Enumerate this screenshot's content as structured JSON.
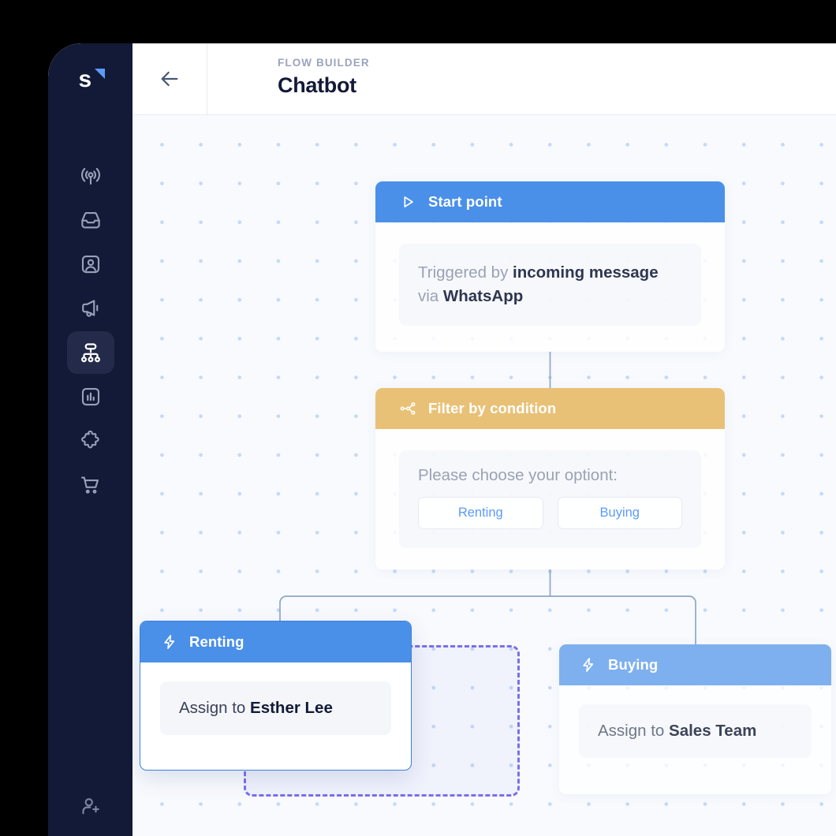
{
  "app": {
    "logo_letter": "s",
    "logo_icon": "triangle-accent"
  },
  "sidebar": {
    "items": [
      {
        "label": "Broadcast",
        "icon": "broadcast-icon",
        "active": false
      },
      {
        "label": "Inbox",
        "icon": "inbox-icon",
        "active": false
      },
      {
        "label": "Contacts",
        "icon": "contact-card-icon",
        "active": false
      },
      {
        "label": "Campaigns",
        "icon": "megaphone-icon",
        "active": false
      },
      {
        "label": "Flow Builder",
        "icon": "flow-sitemap-icon",
        "active": true
      },
      {
        "label": "Analytics",
        "icon": "bar-chart-icon",
        "active": false
      },
      {
        "label": "Integrations",
        "icon": "puzzle-icon",
        "active": false
      },
      {
        "label": "Commerce",
        "icon": "shopping-cart-icon",
        "active": false
      }
    ],
    "bottom_item": {
      "label": "Invite member",
      "icon": "add-user-icon"
    }
  },
  "header": {
    "back_icon": "arrow-left-icon",
    "kicker": "FLOW BUILDER",
    "title": "Chatbot"
  },
  "canvas": {
    "nodes": {
      "start": {
        "icon": "play-triangle-icon",
        "title": "Start point",
        "body_prefix": "Triggered by ",
        "body_bold_1": "incoming message",
        "body_mid": " via ",
        "body_bold_2": "WhatsApp"
      },
      "filter": {
        "icon": "branch-nodes-icon",
        "title": "Filter by condition",
        "prompt": "Please choose your optiont:",
        "options": [
          {
            "label": "Renting"
          },
          {
            "label": "Buying"
          }
        ]
      },
      "renting": {
        "icon": "lightning-bolt-icon",
        "title": "Renting",
        "assign_prefix": "Assign to ",
        "assign_target": "Esther Lee",
        "state": "dragging"
      },
      "buying": {
        "icon": "lightning-bolt-icon",
        "title": "Buying",
        "assign_prefix": "Assign to ",
        "assign_target": "Sales Team"
      }
    },
    "drop_zone": {
      "label": ""
    }
  },
  "colors": {
    "sidebar_bg": "#131A37",
    "sidebar_active_bg": "#242B4A",
    "accent_blue": "#4A90E8",
    "accent_blue_muted": "#7EB0EF",
    "accent_amber": "#E9C176",
    "option_text_blue": "#5B9BF8",
    "drop_zone_purple": "#7C6FE8",
    "canvas_bg": "#F8FAFD",
    "grid_dot": "#C6D8F7",
    "title_dark": "#131A37",
    "kicker_gray": "#9AA4BC"
  }
}
